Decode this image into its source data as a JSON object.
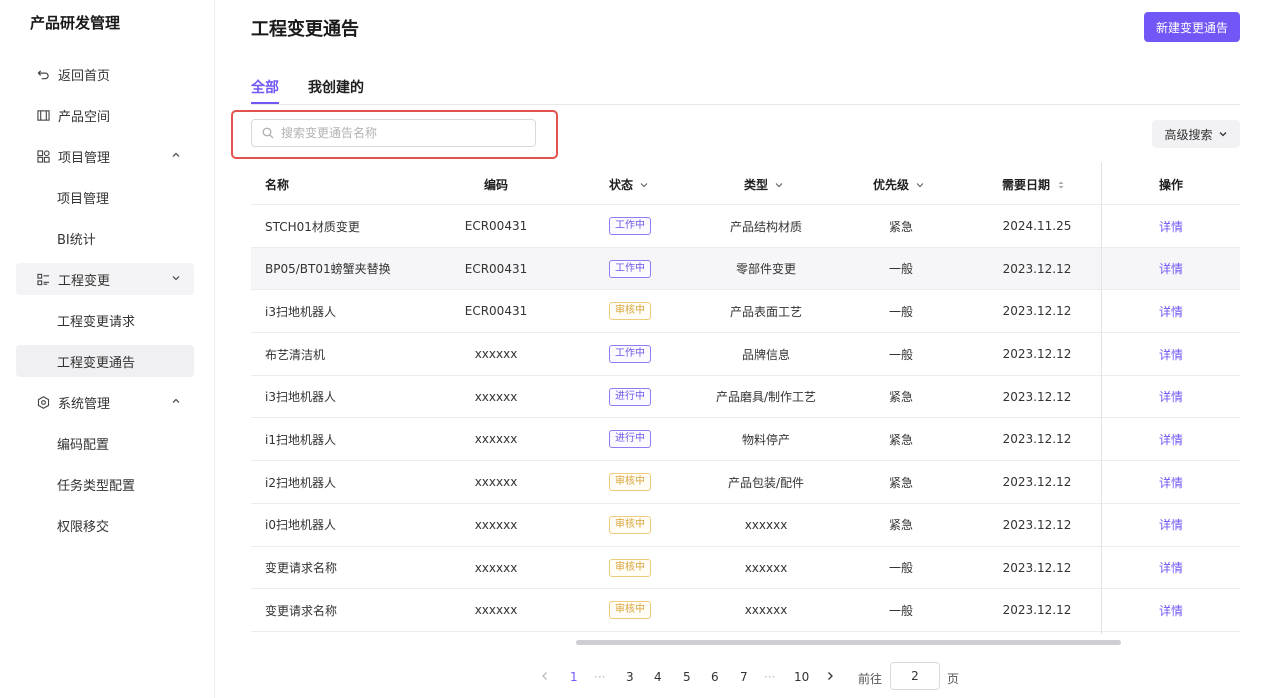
{
  "app_title": "产品研发管理",
  "sidebar": {
    "items": [
      {
        "label": "返回首页",
        "icon": "back-icon"
      },
      {
        "label": "产品空间",
        "icon": "product-space-icon"
      },
      {
        "label": "项目管理",
        "icon": "grid-icon",
        "expanded": true
      },
      {
        "label": "项目管理"
      },
      {
        "label": "BI统计"
      },
      {
        "label": "工程变更",
        "icon": "list-icon",
        "expanded": true
      },
      {
        "label": "工程变更请求"
      },
      {
        "label": "工程变更通告",
        "active": true
      },
      {
        "label": "系统管理",
        "icon": "gear-icon",
        "expanded": true
      },
      {
        "label": "编码配置"
      },
      {
        "label": "任务类型配置"
      },
      {
        "label": "权限移交"
      }
    ]
  },
  "header": {
    "title": "工程变更通告",
    "new_button": "新建变更通告"
  },
  "tabs": [
    {
      "label": "全部",
      "active": true
    },
    {
      "label": "我创建的"
    }
  ],
  "search": {
    "placeholder": "搜索变更通告名称",
    "value": ""
  },
  "advanced_search": "高级搜索",
  "table": {
    "headers": {
      "name": "名称",
      "code": "编码",
      "status": "状态",
      "type": "类型",
      "priority": "优先级",
      "date": "需要日期",
      "op": "操作"
    },
    "rows": [
      {
        "name": "STCH01材质变更",
        "code": "ECR00431",
        "status": "工作中",
        "status_color": "purple",
        "type": "产品结构材质",
        "priority": "紧急",
        "date": "2024.11.25",
        "op": "详情"
      },
      {
        "name": "BP05/BT01螃蟹夹替换",
        "code": "ECR00431",
        "status": "工作中",
        "status_color": "purple",
        "type": "零部件变更",
        "priority": "一般",
        "date": "2023.12.12",
        "op": "详情"
      },
      {
        "name": "i3扫地机器人",
        "code": "ECR00431",
        "status": "审核中",
        "status_color": "yellow",
        "type": "产品表面工艺",
        "priority": "一般",
        "date": "2023.12.12",
        "op": "详情"
      },
      {
        "name": "布艺清洁机",
        "code": "xxxxxx",
        "status": "工作中",
        "status_color": "purple",
        "type": "品牌信息",
        "priority": "一般",
        "date": "2023.12.12",
        "op": "详情"
      },
      {
        "name": "i3扫地机器人",
        "code": "xxxxxx",
        "status": "进行中",
        "status_color": "purple",
        "type": "产品磨具/制作工艺",
        "priority": "紧急",
        "date": "2023.12.12",
        "op": "详情"
      },
      {
        "name": "i1扫地机器人",
        "code": "xxxxxx",
        "status": "进行中",
        "status_color": "purple",
        "type": "物料停产",
        "priority": "紧急",
        "date": "2023.12.12",
        "op": "详情"
      },
      {
        "name": "i2扫地机器人",
        "code": "xxxxxx",
        "status": "审核中",
        "status_color": "yellow",
        "type": "产品包装/配件",
        "priority": "紧急",
        "date": "2023.12.12",
        "op": "详情"
      },
      {
        "name": "i0扫地机器人",
        "code": "xxxxxx",
        "status": "审核中",
        "status_color": "yellow",
        "type": "xxxxxx",
        "priority": "紧急",
        "date": "2023.12.12",
        "op": "详情"
      },
      {
        "name": "变更请求名称",
        "code": "xxxxxx",
        "status": "审核中",
        "status_color": "yellow",
        "type": "xxxxxx",
        "priority": "一般",
        "date": "2023.12.12",
        "op": "详情"
      },
      {
        "name": "变更请求名称",
        "code": "xxxxxx",
        "status": "审核中",
        "status_color": "yellow",
        "type": "xxxxxx",
        "priority": "一般",
        "date": "2023.12.12",
        "op": "详情"
      }
    ]
  },
  "pagination": {
    "pages": [
      "1",
      "···",
      "3",
      "4",
      "5",
      "6",
      "7",
      "···",
      "10"
    ],
    "current": "1",
    "goto_label": "前往",
    "goto_value": "2",
    "page_suffix": "页"
  },
  "colors": {
    "accent": "#7357f6",
    "highlight_outline": "#e3524f",
    "status_purple": "#6f57e8",
    "status_yellow": "#d9a43b"
  }
}
